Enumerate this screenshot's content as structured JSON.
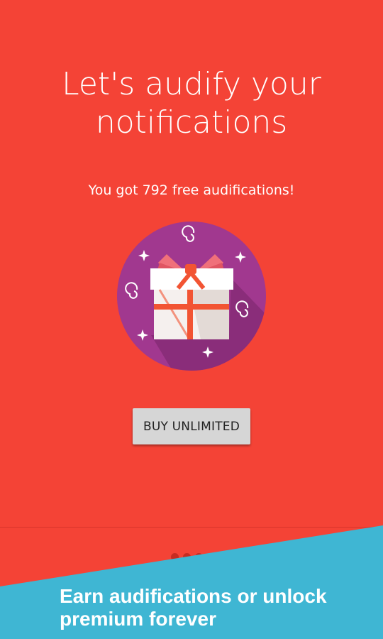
{
  "header": {
    "title_line1": "Let's audify your",
    "title_line2": "notifications"
  },
  "status": {
    "free_audifications_text": "You got 792 free audifications!"
  },
  "actions": {
    "buy_label": "BUY UNLIMITED"
  },
  "pager": {
    "page_count": 3,
    "active_index": 0
  },
  "promo": {
    "line1": "Earn audifications or unlock",
    "line2": "premium forever"
  },
  "icons": {
    "hero": "gift-icon"
  },
  "colors": {
    "background": "#f44336",
    "banner": "#3fb6d3",
    "circle": "#a1388f",
    "ribbon": "#f25433",
    "button": "#d6d6d6"
  }
}
